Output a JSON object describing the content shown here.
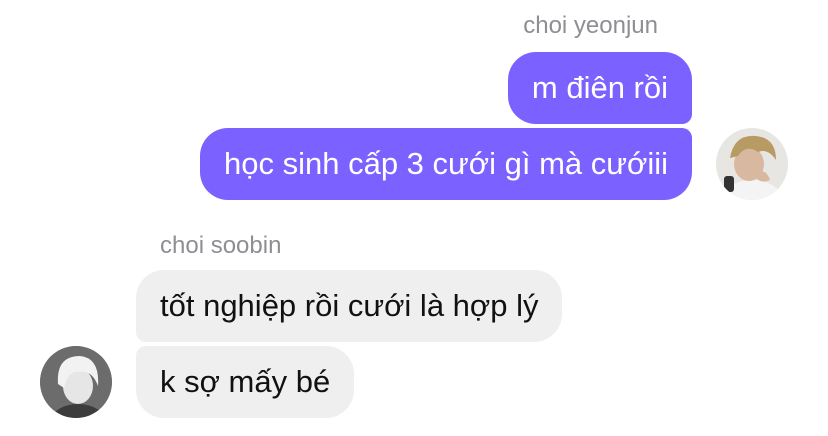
{
  "thread": {
    "outgoing_group": {
      "sender": "choi yeonjun",
      "messages": [
        {
          "text": "m điên rồi"
        },
        {
          "text": "học sinh cấp 3 cưới gì mà cướiii"
        }
      ],
      "avatar_icon": "user-avatar-photo"
    },
    "incoming_group": {
      "sender": "choi soobin",
      "messages": [
        {
          "text": "tốt nghiệp rồi cưới là hợp lý"
        },
        {
          "text": "k sợ mấy bé"
        }
      ],
      "avatar_icon": "user-avatar-photo"
    }
  },
  "colors": {
    "outgoing_bubble": "#7b61ff",
    "incoming_bubble": "#efeff0",
    "sender_name": "#8e8e93"
  }
}
